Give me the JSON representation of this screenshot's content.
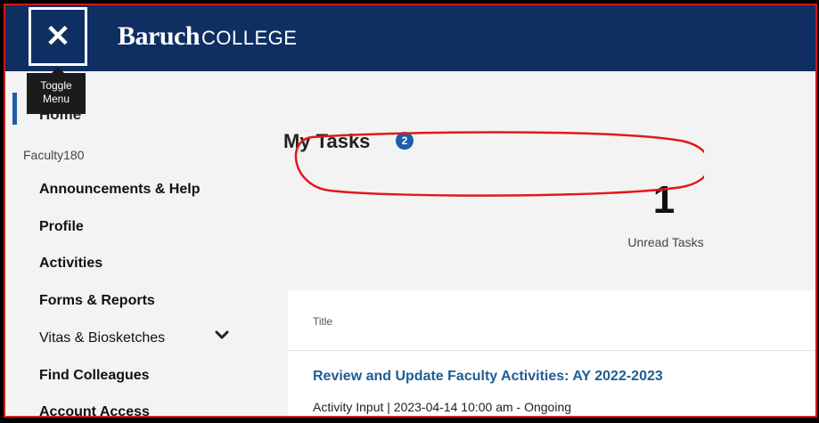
{
  "header": {
    "toggle_icon": "close-icon",
    "logo_bold": "Baruch",
    "logo_light": "COLLEGE",
    "brand_color": "#0f2f63"
  },
  "tooltip": {
    "text_line1": "Toggle",
    "text_line2": "Menu"
  },
  "sidebar": {
    "home_label": "Home",
    "section_label": "Faculty180",
    "items": [
      {
        "label": "Announcements & Help"
      },
      {
        "label": "Profile"
      },
      {
        "label": "Activities"
      },
      {
        "label": "Forms & Reports"
      },
      {
        "label": "Vitas & Biosketches"
      },
      {
        "label": "Find Colleagues"
      },
      {
        "label": "Account Access"
      }
    ],
    "chevron_icon": "chevron-down-icon"
  },
  "main": {
    "title": "My Tasks",
    "badge_count": "2",
    "stat_value": "1",
    "stat_label": "Unread Tasks",
    "table": {
      "column_title": "Title",
      "rows": [
        {
          "title": "Review and Update Faculty Activities: AY 2022-2023",
          "subtitle": "Activity Input | 2023-04-14 10:00 am - Ongoing"
        }
      ]
    }
  },
  "annotation": {
    "color": "#e0191b"
  }
}
